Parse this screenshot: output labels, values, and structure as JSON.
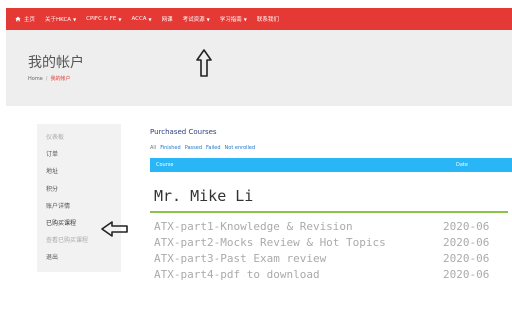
{
  "nav": {
    "items": [
      {
        "label": "主页",
        "caret": false
      },
      {
        "label": "关于HKCA",
        "caret": true
      },
      {
        "label": "CPIFC & FE",
        "caret": true
      },
      {
        "label": "ACCA",
        "caret": true
      },
      {
        "label": "网课",
        "caret": false
      },
      {
        "label": "考试资源",
        "caret": true
      },
      {
        "label": "学习指南",
        "caret": true
      },
      {
        "label": "联系我们",
        "caret": false
      }
    ]
  },
  "header": {
    "title": "我的帐户",
    "breadcrumb": [
      "Home",
      "我的帐户"
    ]
  },
  "sidebar": {
    "items": [
      {
        "label": "仪表板",
        "state": "muted"
      },
      {
        "label": "订单",
        "state": "normal"
      },
      {
        "label": "地址",
        "state": "normal"
      },
      {
        "label": "积分",
        "state": "normal"
      },
      {
        "label": "账户详情",
        "state": "normal"
      },
      {
        "label": "已购买课程",
        "state": "active"
      },
      {
        "label": "查看已购买课程",
        "state": "muted"
      },
      {
        "label": "退出",
        "state": "normal"
      }
    ]
  },
  "main": {
    "section_title": "Purchased Courses",
    "filters": [
      "All",
      "Finished",
      "Passed",
      "Failed",
      "Not enrolled"
    ],
    "columns": {
      "course": "Course",
      "date": "Date"
    },
    "student_name": "Mr. Mike Li",
    "courses": [
      {
        "title": "ATX-part1-Knowledge & Revision",
        "date": "2020-06"
      },
      {
        "title": "ATX-part2-Mocks Review & Hot Topics",
        "date": "2020-06"
      },
      {
        "title": "ATX-part3-Past Exam review",
        "date": "2020-06"
      },
      {
        "title": "ATX-part4-pdf to download",
        "date": "2020-06"
      }
    ]
  },
  "colors": {
    "nav_bg": "#e53935",
    "table_header_bg": "#29b6f6",
    "accent_line": "#8bc34a"
  }
}
